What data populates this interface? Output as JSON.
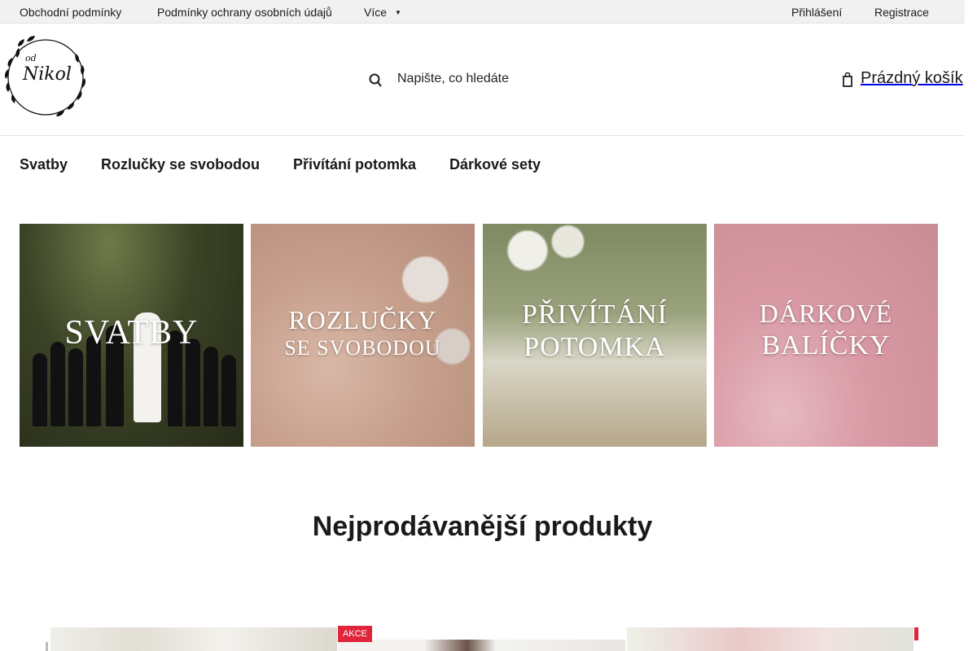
{
  "topbar": {
    "links": [
      "Obchodní podmínky",
      "Podmínky ochrany osobních údajů"
    ],
    "more_label": "Více",
    "login_label": "Přihlášení",
    "register_label": "Registrace"
  },
  "header": {
    "logo_text": [
      "od",
      "Nikol"
    ],
    "search_placeholder": "Napište, co hledáte",
    "cart_label": "Prázdný košík"
  },
  "nav": {
    "items": [
      "Svatby",
      "Rozlučky se svobodou",
      "Přivítání potomka",
      "Dárkové sety"
    ]
  },
  "tiles": [
    {
      "lines": [
        "Svatby"
      ]
    },
    {
      "lines": [
        "Rozlučky",
        "se svobodou"
      ]
    },
    {
      "lines": [
        "Přivítání",
        "potomka"
      ]
    },
    {
      "lines": [
        "Dárkové",
        "balíčky"
      ]
    }
  ],
  "bestsellers": {
    "heading": "Nejprodávanější produkty",
    "badge": "AKCE"
  },
  "colors": {
    "accent": "#e0253a",
    "topbar_bg": "#f1f1f1"
  },
  "icons": {
    "search": "magnifier-icon",
    "cart": "cart-icon",
    "more": "chevron-down-icon"
  }
}
